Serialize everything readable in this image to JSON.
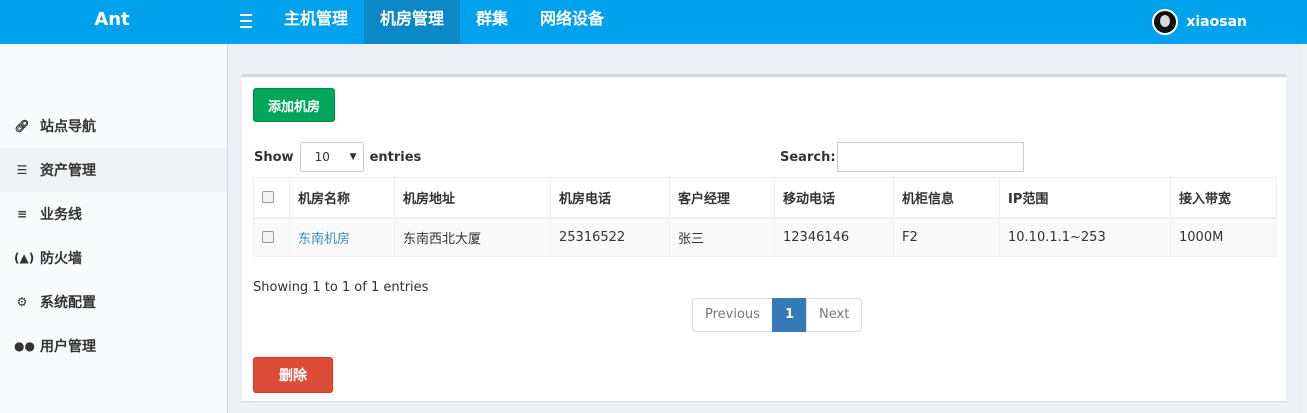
{
  "brand": "Ant",
  "topnav": [
    {
      "label": "主机管理",
      "active": false
    },
    {
      "label": "机房管理",
      "active": true
    },
    {
      "label": "群集",
      "active": false
    },
    {
      "label": "网络设备",
      "active": false
    }
  ],
  "user": {
    "name": "xiaosan"
  },
  "sidebar": {
    "items": [
      {
        "label": "站点导航",
        "icon": "link-icon",
        "active": false
      },
      {
        "label": "资产管理",
        "icon": "database-icon",
        "active": true
      },
      {
        "label": "业务线",
        "icon": "list-icon",
        "active": false
      },
      {
        "label": "防火墙",
        "icon": "firewall-icon",
        "active": false
      },
      {
        "label": "系统配置",
        "icon": "gear-icon",
        "active": false
      },
      {
        "label": "用户管理",
        "icon": "users-icon",
        "active": false
      }
    ]
  },
  "toolbar": {
    "add_label": "添加机房",
    "delete_label": "删除"
  },
  "length": {
    "show_label": "Show",
    "value": "10",
    "entries_label": "entries"
  },
  "search": {
    "label": "Search:",
    "value": ""
  },
  "table": {
    "headers": [
      "机房名称",
      "机房地址",
      "机房电话",
      "客户经理",
      "移动电话",
      "机柜信息",
      "IP范围",
      "接入带宽"
    ],
    "rows": [
      {
        "name": "东南机房",
        "address": "东南西北大厦",
        "phone": "25316522",
        "manager": "张三",
        "mobile": "12346146",
        "cabinet": "F2",
        "ip_range": "10.10.1.1~253",
        "bandwidth": "1000M"
      }
    ]
  },
  "info": "Showing 1 to 1 of 1 entries",
  "pagination": {
    "previous": "Previous",
    "current": "1",
    "next": "Next"
  },
  "colors": {
    "topbar": "#00a2ee",
    "topnav_active": "#0c88c8",
    "add_button": "#00a65a",
    "delete_button": "#dd4b39",
    "page_active": "#337ab7",
    "link": "#3c8dbc"
  }
}
